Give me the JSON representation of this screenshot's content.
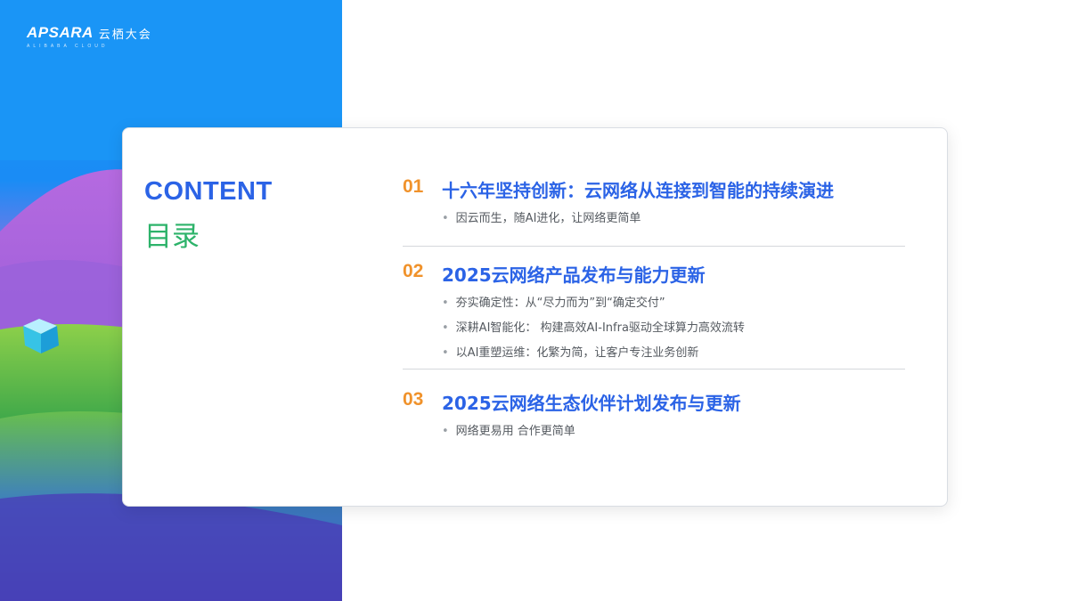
{
  "brand": {
    "logo_text": "APSARA",
    "logo_cn": "云栖大会",
    "logo_sub": "ALIBABA CLOUD"
  },
  "toc": {
    "heading_en": "CONTENT",
    "heading_cn": "目录",
    "sections": [
      {
        "num": "01",
        "title": "十六年坚持创新：云网络从连接到智能的持续演进",
        "bullets": [
          "因云而生，随AI进化，让网络更简单"
        ]
      },
      {
        "num": "02",
        "title": "2025云网络产品发布与能力更新",
        "bullets": [
          "夯实确定性：从“尽力而为”到“确定交付”",
          "深耕AI智能化：  构建高效AI-Infra驱动全球算力高效流转",
          "以AI重塑运维：化繁为简，让客户专注业务创新"
        ]
      },
      {
        "num": "03",
        "title": "2025云网络生态伙伴计划发布与更新",
        "bullets": [
          "网络更易用 合作更简单"
        ]
      }
    ]
  },
  "colors": {
    "accent_blue": "#2b63e6",
    "accent_green": "#2db36a",
    "accent_orange": "#f0922b",
    "panel_blue": "#1a95f6"
  }
}
